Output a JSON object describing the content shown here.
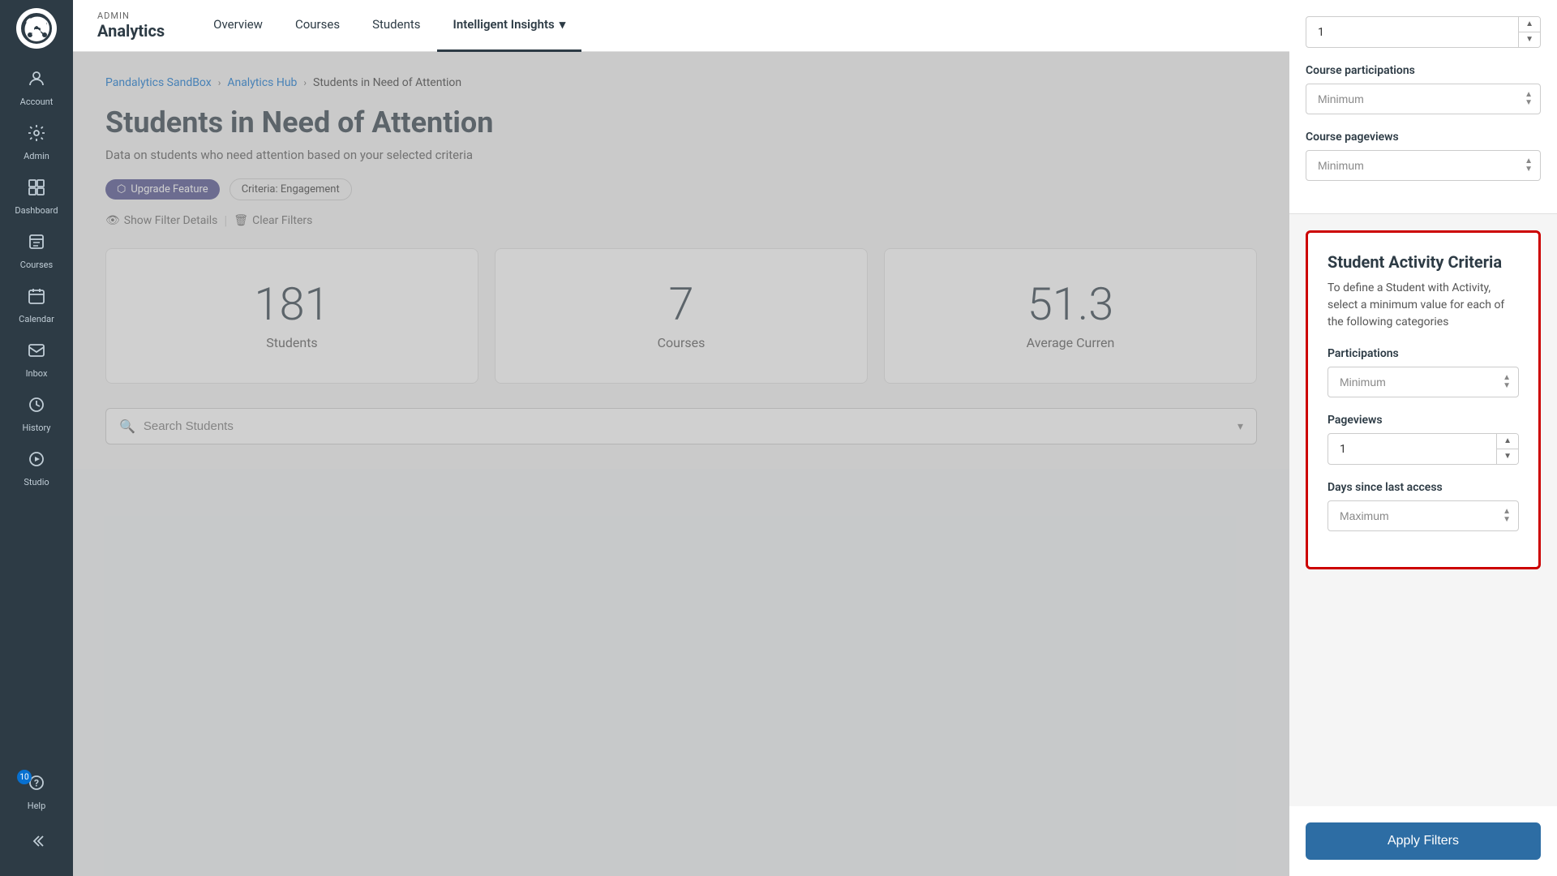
{
  "app": {
    "admin_label": "ADMIN",
    "brand_name": "Analytics"
  },
  "sidebar": {
    "logo_alt": "Canvas Logo",
    "items": [
      {
        "id": "account",
        "label": "Account",
        "icon": "👤"
      },
      {
        "id": "admin",
        "label": "Admin",
        "icon": "⚙"
      },
      {
        "id": "dashboard",
        "label": "Dashboard",
        "icon": "📊"
      },
      {
        "id": "courses",
        "label": "Courses",
        "icon": "📋"
      },
      {
        "id": "calendar",
        "label": "Calendar",
        "icon": "📅"
      },
      {
        "id": "inbox",
        "label": "Inbox",
        "icon": "✉"
      },
      {
        "id": "history",
        "label": "History",
        "icon": "🕐"
      },
      {
        "id": "studio",
        "label": "Studio",
        "icon": "▶"
      },
      {
        "id": "help",
        "label": "Help",
        "icon": "❓",
        "badge": "10"
      }
    ],
    "collapse_label": "Collapse"
  },
  "topnav": {
    "admin_label": "ADMIN",
    "brand": "Analytics",
    "links": [
      {
        "id": "overview",
        "label": "Overview",
        "active": false
      },
      {
        "id": "courses",
        "label": "Courses",
        "active": false
      },
      {
        "id": "students",
        "label": "Students",
        "active": false
      },
      {
        "id": "intelligent-insights",
        "label": "Intelligent Insights",
        "active": true,
        "has_dropdown": true
      }
    ]
  },
  "breadcrumb": {
    "items": [
      {
        "label": "Pandalytics SandBox",
        "link": true
      },
      {
        "label": "Analytics Hub",
        "link": true
      },
      {
        "label": "Students in Need of Attention",
        "link": false
      }
    ]
  },
  "page": {
    "title": "Students in Need of Attention",
    "subtitle": "Data on students who need attention based on your selected criteria",
    "badge_upgrade": "Upgrade Feature",
    "badge_criteria": "Criteria: Engagement",
    "show_filter_details": "Show Filter Details",
    "clear_filters": "Clear Filters"
  },
  "stats": [
    {
      "id": "students",
      "value": "181",
      "label": "Students"
    },
    {
      "id": "courses",
      "value": "7",
      "label": "Courses"
    },
    {
      "id": "average",
      "value": "51.3",
      "label": "Average Curren"
    }
  ],
  "search": {
    "placeholder": "Search Students"
  },
  "right_panel": {
    "course_participations": {
      "label": "Course participations",
      "value": "1",
      "placeholder_select": "Minimum"
    },
    "course_pageviews": {
      "label": "Course pageviews",
      "placeholder_select": "Minimum"
    }
  },
  "activity_criteria": {
    "title": "Student Activity Criteria",
    "description": "To define a Student with Activity, select a minimum value for each of the following categories",
    "fields": [
      {
        "id": "participations",
        "label": "Participations",
        "value": "Minimum",
        "type": "select"
      },
      {
        "id": "pageviews",
        "label": "Pageviews",
        "value": "1",
        "type": "spinner"
      },
      {
        "id": "days_since",
        "label": "Days since last access",
        "value": "Maximum",
        "type": "select"
      }
    ],
    "apply_button": "Apply Filters"
  }
}
